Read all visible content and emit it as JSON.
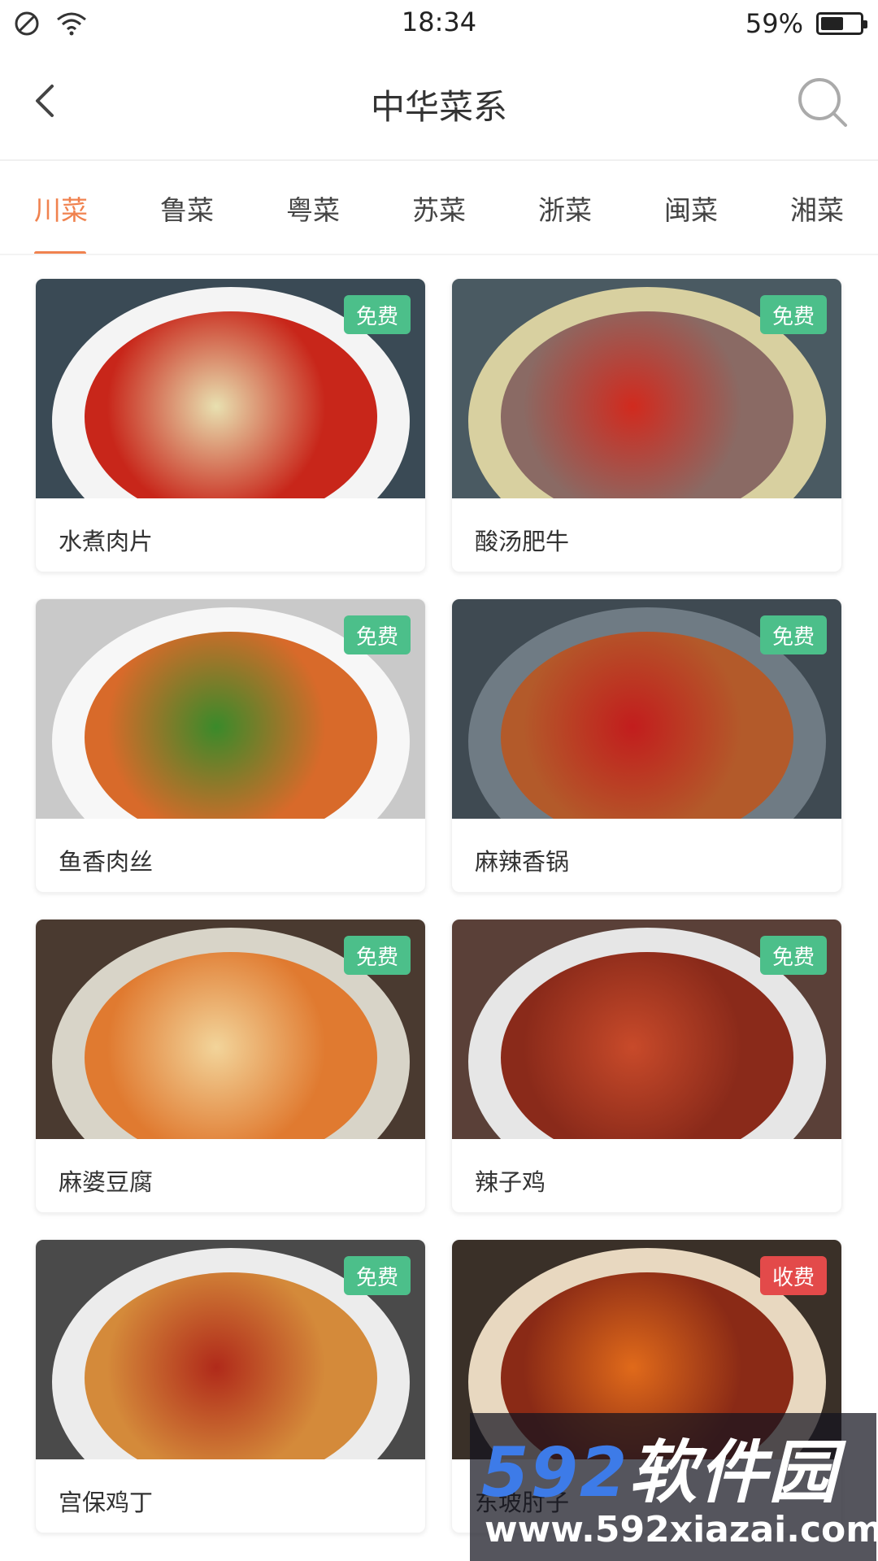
{
  "status": {
    "time": "18:34",
    "battery": "59%",
    "battery_level": 0.59,
    "icons": [
      "dnd-icon",
      "wifi-icon",
      "battery-icon"
    ]
  },
  "header": {
    "title": "中华菜系",
    "back_icon": "back-chevron-icon",
    "search_icon": "search-icon"
  },
  "tabs": [
    "川菜",
    "鲁菜",
    "粤菜",
    "苏菜",
    "浙菜",
    "闽菜",
    "湘菜"
  ],
  "active_tab": 0,
  "cards": [
    {
      "title": "水煮肉片",
      "badge": "免费",
      "badge_type": "free"
    },
    {
      "title": "酸汤肥牛",
      "badge": "免费",
      "badge_type": "free"
    },
    {
      "title": "鱼香肉丝",
      "badge": "免费",
      "badge_type": "free"
    },
    {
      "title": "麻辣香锅",
      "badge": "免费",
      "badge_type": "free"
    },
    {
      "title": "麻婆豆腐",
      "badge": "免费",
      "badge_type": "free"
    },
    {
      "title": "辣子鸡",
      "badge": "免费",
      "badge_type": "free"
    },
    {
      "title": "宫保鸡丁",
      "badge": "免费",
      "badge_type": "free"
    },
    {
      "title": "东坡肘子",
      "badge": "收费",
      "badge_type": "paid"
    }
  ],
  "colors": {
    "accent": "#f0824f",
    "free_badge": "#4cbf8a",
    "paid_badge": "#e34a4a"
  },
  "watermark": {
    "brand_num": "592",
    "brand_cn": "软件园",
    "url": "www.592xiazai.com"
  }
}
